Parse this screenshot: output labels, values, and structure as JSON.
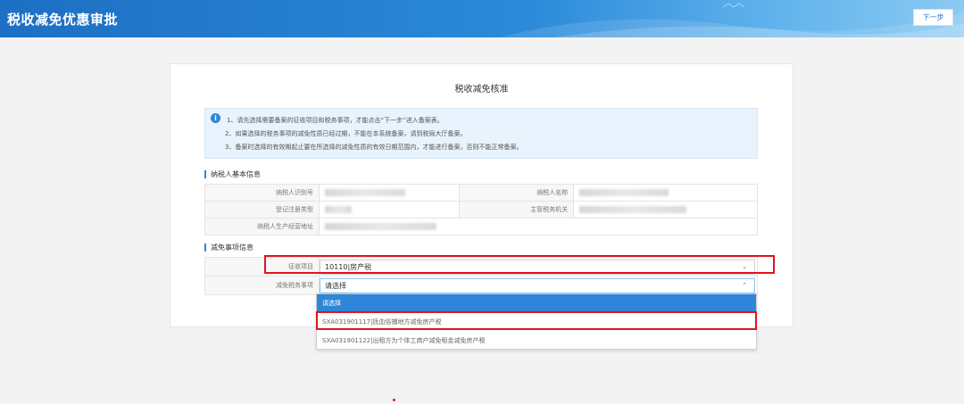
{
  "header": {
    "title": "税收减免优惠审批",
    "next_button": "下一步"
  },
  "card": {
    "title": "税收减免核准",
    "notice": {
      "line1": "1、请先选择需要备案的征收项目和税务事项，才能点击“下一步”进入备案表。",
      "line2": "2、如果选择的税务事项的减免性质已经过期，不能在本系统备案，请到税局大厅备案。",
      "line3": "3、备案时选择的有效期起止要在所选择的减免性质的有效日期范围内，才能进行备案，否则不能正常备案。"
    },
    "basic_section": "纳税人基本信息",
    "basic_fields": {
      "taxpayer_id_label": "纳税人识别号",
      "taxpayer_name_label": "纳税人名称",
      "reg_type_label": "登记注册类型",
      "tax_office_label": "主管税务机关",
      "address_label": "纳税人生产经营地址"
    },
    "relief_section": "减免事项信息",
    "levy_item_label": "征收项目",
    "levy_item_value": "10110|房产税",
    "tax_matter_label": "减免税务事项",
    "tax_matter_value": "请选择"
  },
  "dropdown": {
    "options": [
      "请选择",
      "SXA031901117|抚血俗捕地方减免房产税",
      "SXA031901122|出租方为个体工商户减免租金减免房产税"
    ]
  },
  "colors": {
    "brand": "#2f86d8",
    "highlight": "#e0141e"
  }
}
